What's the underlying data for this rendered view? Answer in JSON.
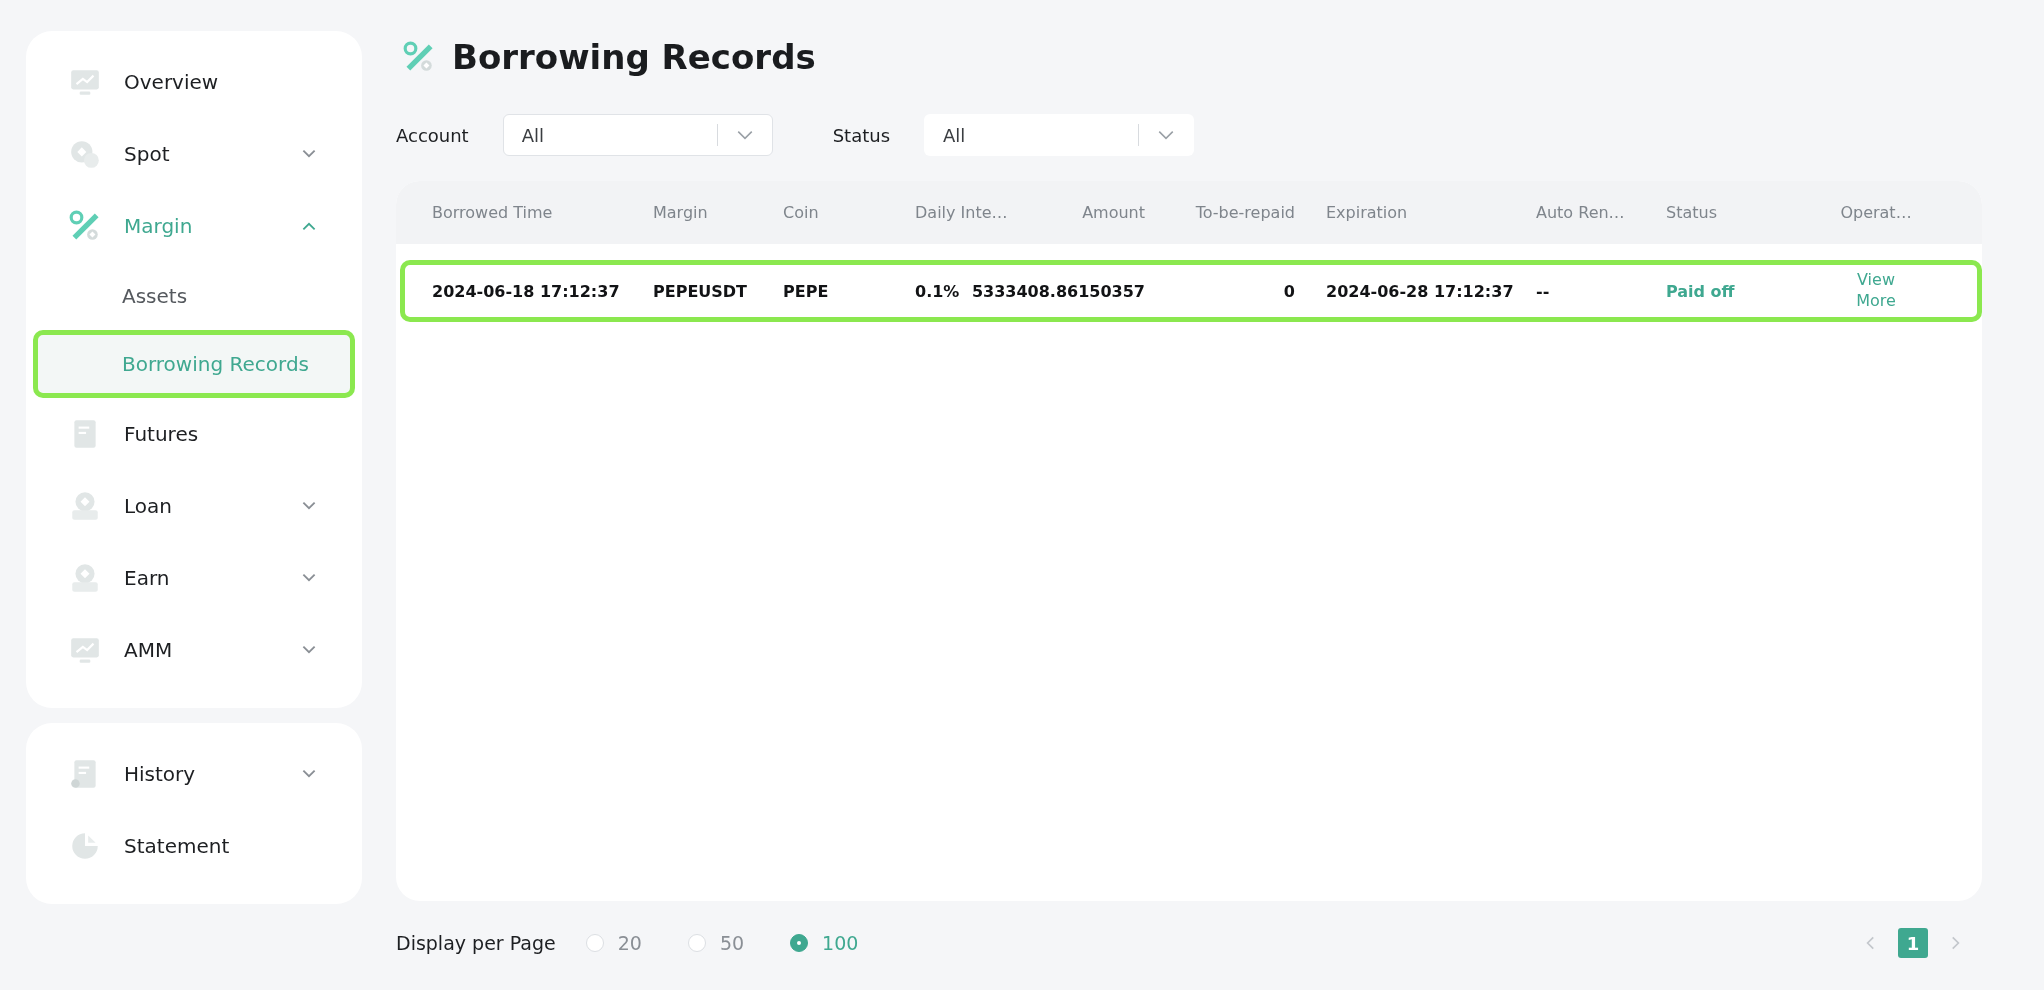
{
  "sidebar": {
    "sections": [
      {
        "items": [
          {
            "label": "Overview",
            "selected": false
          },
          {
            "label": "Spot",
            "expanded": false,
            "selected": false
          },
          {
            "label": "Margin",
            "expanded": true,
            "selected": true,
            "children": [
              {
                "label": "Assets",
                "selected": false,
                "highlighted": false
              },
              {
                "label": "Borrowing Records",
                "selected": true,
                "highlighted": true
              }
            ]
          },
          {
            "label": "Futures",
            "selected": false
          },
          {
            "label": "Loan",
            "expanded": false,
            "selected": false
          },
          {
            "label": "Earn",
            "expanded": false,
            "selected": false
          },
          {
            "label": "AMM",
            "expanded": false,
            "selected": false
          }
        ]
      },
      {
        "items": [
          {
            "label": "History",
            "expanded": false,
            "selected": false
          },
          {
            "label": "Statement",
            "selected": false
          }
        ]
      }
    ]
  },
  "page": {
    "title": "Borrowing Records"
  },
  "filters": [
    {
      "label": "Account",
      "value": "All",
      "bordered": true
    },
    {
      "label": "Status",
      "value": "All",
      "bordered": false
    }
  ],
  "table": {
    "columns": [
      "Borrowed Time",
      "Margin",
      "Coin",
      "Daily Inte…",
      "Amount",
      "To-be-repaid",
      "Expiration",
      "Auto Ren…",
      "Status",
      "Operat…"
    ],
    "rows": [
      {
        "highlighted": true,
        "cells": [
          "2024-06-18 17:12:37",
          "PEPEUSDT",
          "PEPE",
          "0.1%",
          "5333408.86150357",
          "0",
          "2024-06-28 17:12:37",
          "--",
          "Paid off",
          "View More"
        ]
      }
    ]
  },
  "footer": {
    "label": "Display per Page",
    "page_sizes": [
      {
        "label": "20",
        "selected": false
      },
      {
        "label": "50",
        "selected": false
      },
      {
        "label": "100",
        "selected": true
      }
    ],
    "pages": [
      {
        "label": "1",
        "selected": true
      }
    ]
  }
}
